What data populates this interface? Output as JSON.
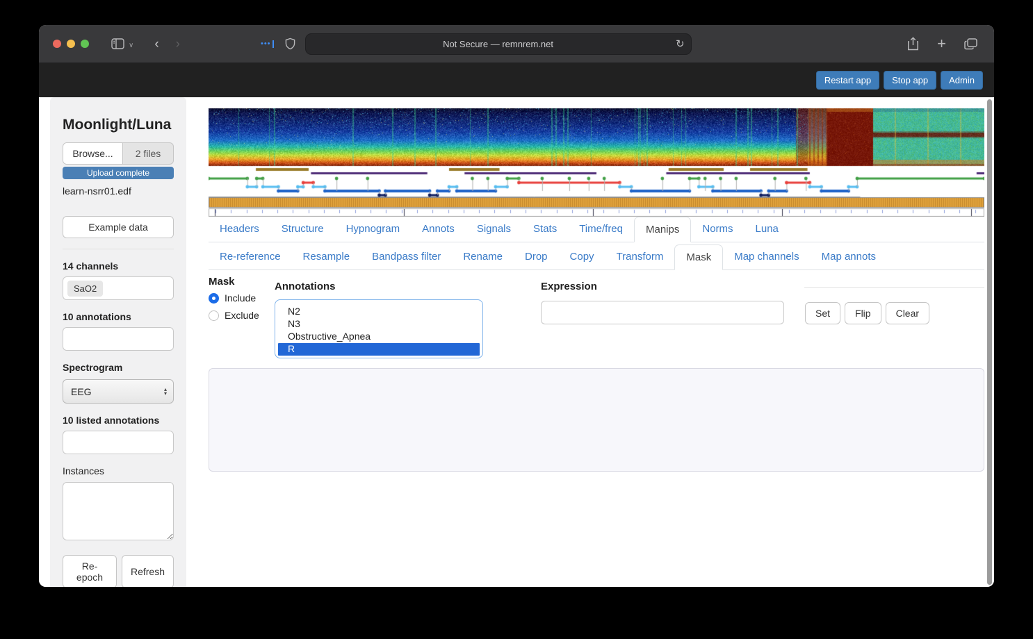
{
  "browser": {
    "url_text": "Not Secure — remnrem.net",
    "reload_glyph": "↻",
    "back_glyph": "‹",
    "forward_glyph": "›",
    "chevron_glyph": "∨",
    "ellipsis_glyph": "•••",
    "plus_glyph": "+"
  },
  "navbar": {
    "restart_label": "Restart app",
    "stop_label": "Stop app",
    "admin_label": "Admin",
    "button_color": "#3e7cb9",
    "bg_color": "#212121"
  },
  "sidebar": {
    "title": "Moonlight/Luna",
    "browse_label": "Browse...",
    "files_label": "2 files",
    "upload_status": "Upload complete",
    "upload_color": "#4a7fb5",
    "file_name": "learn-nsrr01.edf",
    "example_button": "Example data",
    "channels_label": "14 channels",
    "channel_tag": "SaO2",
    "annotations_label": "10 annotations",
    "spectrogram_label": "Spectrogram",
    "spectrogram_value": "EEG",
    "select_up_glyph": "▴",
    "select_down_glyph": "▾",
    "listed_annotations_label": "10 listed annotations",
    "instances_label": "Instances",
    "reepoch_button": "Re-epoch",
    "refresh_button": "Refresh"
  },
  "tabs": {
    "active": "Manips",
    "items": [
      {
        "label": "Headers"
      },
      {
        "label": "Structure"
      },
      {
        "label": "Hypnogram"
      },
      {
        "label": "Annots"
      },
      {
        "label": "Signals"
      },
      {
        "label": "Stats"
      },
      {
        "label": "Time/freq"
      },
      {
        "label": "Manips"
      },
      {
        "label": "Norms"
      },
      {
        "label": "Luna"
      }
    ]
  },
  "subtabs": {
    "active": "Mask",
    "items": [
      {
        "label": "Re-reference"
      },
      {
        "label": "Resample"
      },
      {
        "label": "Bandpass filter"
      },
      {
        "label": "Rename"
      },
      {
        "label": "Drop"
      },
      {
        "label": "Copy"
      },
      {
        "label": "Transform"
      },
      {
        "label": "Mask"
      },
      {
        "label": "Map channels"
      },
      {
        "label": "Map annots"
      }
    ]
  },
  "mask_panel": {
    "mask_label": "Mask",
    "include_label": "Include",
    "exclude_label": "Exclude",
    "include_selected": true,
    "annotations_label": "Annotations",
    "annotation_options": [
      "N2",
      "N3",
      "Obstructive_Apnea",
      "R"
    ],
    "selected_option": "R",
    "selection_color": "#2267d6",
    "expression_label": "Expression",
    "expression_value": "",
    "set_button": "Set",
    "flip_button": "Flip",
    "clear_button": "Clear"
  },
  "viz": {
    "stage_colors": {
      "W": "#43a047",
      "R": "#e8413c",
      "N1": "#56bdf0",
      "N2": "#1f63c9",
      "N3": "#101f63"
    },
    "hypnogram": [
      [
        0.0,
        0.05,
        "W"
      ],
      [
        0.05,
        0.062,
        "N1"
      ],
      [
        0.062,
        0.07,
        "W"
      ],
      [
        0.07,
        0.09,
        "N1"
      ],
      [
        0.09,
        0.115,
        "N2"
      ],
      [
        0.115,
        0.122,
        "N1"
      ],
      [
        0.122,
        0.135,
        "R"
      ],
      [
        0.135,
        0.15,
        "N1"
      ],
      [
        0.15,
        0.22,
        "N2"
      ],
      [
        0.22,
        0.228,
        "N3"
      ],
      [
        0.228,
        0.285,
        "N2"
      ],
      [
        0.285,
        0.295,
        "N3"
      ],
      [
        0.295,
        0.31,
        "N2"
      ],
      [
        0.31,
        0.32,
        "N1"
      ],
      [
        0.32,
        0.37,
        "N2"
      ],
      [
        0.37,
        0.385,
        "N1"
      ],
      [
        0.385,
        0.4,
        "W"
      ],
      [
        0.4,
        0.53,
        "R"
      ],
      [
        0.53,
        0.545,
        "N1"
      ],
      [
        0.545,
        0.62,
        "N2"
      ],
      [
        0.62,
        0.632,
        "W"
      ],
      [
        0.632,
        0.65,
        "N1"
      ],
      [
        0.65,
        0.712,
        "N2"
      ],
      [
        0.712,
        0.722,
        "N3"
      ],
      [
        0.722,
        0.745,
        "N2"
      ],
      [
        0.745,
        0.775,
        "R"
      ],
      [
        0.775,
        0.79,
        "N1"
      ],
      [
        0.79,
        0.825,
        "N2"
      ],
      [
        0.825,
        0.836,
        "N1"
      ],
      [
        0.836,
        1.0,
        "W"
      ]
    ],
    "wake_dots": [
      0.165,
      0.205,
      0.34,
      0.36,
      0.43,
      0.465,
      0.49,
      0.51,
      0.585,
      0.64,
      0.66,
      0.68,
      0.73,
      0.77
    ],
    "annotations_brown": [
      [
        0.061,
        0.129
      ],
      [
        0.31,
        0.375
      ],
      [
        0.593,
        0.664
      ],
      [
        0.698,
        0.772
      ]
    ],
    "annotations_purple": [
      [
        0.132,
        0.282
      ],
      [
        0.33,
        0.5
      ],
      [
        0.59,
        0.775
      ],
      [
        0.99,
        1.0
      ]
    ],
    "brown_color": "#9a7b2a",
    "purple_color": "#4f2d78",
    "band_color": "#e2a33c",
    "baseline_end": 0.84,
    "transition_zone": [
      0.772,
      0.797
    ],
    "hot_zone": [
      0.797,
      0.856
    ],
    "green_zone_start": 0.856
  }
}
